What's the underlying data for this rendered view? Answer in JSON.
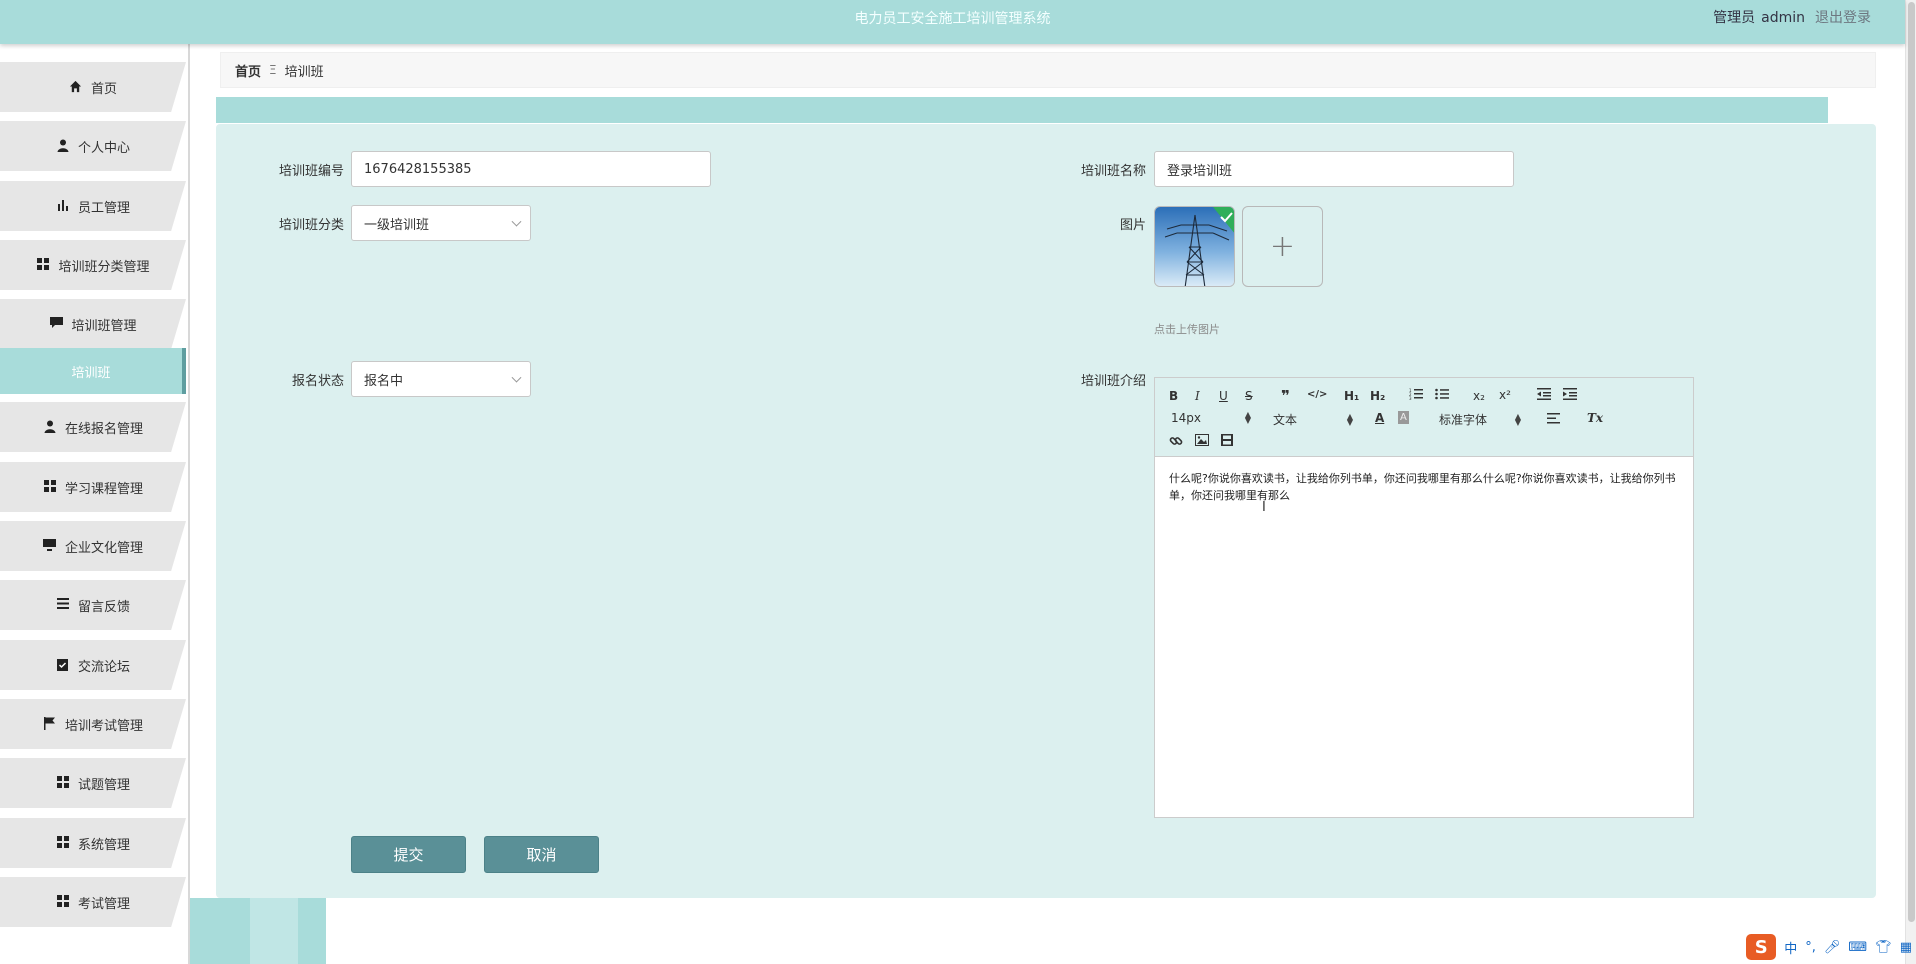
{
  "header": {
    "app_title": "电力员工安全施工培训管理系统",
    "role": "管理员",
    "username": "admin",
    "logout_label": "退出登录"
  },
  "sidebar": {
    "items": [
      {
        "label": "首页",
        "icon": "home-icon"
      },
      {
        "label": "个人中心",
        "icon": "user-icon"
      },
      {
        "label": "员工管理",
        "icon": "bar-chart-icon"
      },
      {
        "label": "培训班分类管理",
        "icon": "grid-icon"
      },
      {
        "label": "培训班管理",
        "icon": "comment-icon"
      },
      {
        "label": "培训班",
        "icon": "",
        "active": true
      },
      {
        "label": "在线报名管理",
        "icon": "user-tie-icon"
      },
      {
        "label": "学习课程管理",
        "icon": "grid-icon"
      },
      {
        "label": "企业文化管理",
        "icon": "monitor-icon"
      },
      {
        "label": "留言反馈",
        "icon": "list-icon"
      },
      {
        "label": "交流论坛",
        "icon": "clipboard-check-icon"
      },
      {
        "label": "培训考试管理",
        "icon": "flag-icon"
      },
      {
        "label": "试题管理",
        "icon": "grid-icon"
      },
      {
        "label": "系统管理",
        "icon": "grid-icon"
      },
      {
        "label": "考试管理",
        "icon": "grid-icon"
      }
    ]
  },
  "breadcrumb": {
    "home": "首页",
    "separator": "Ξ",
    "current": "培训班"
  },
  "form": {
    "class_no_label": "培训班编号",
    "class_no_value": "1676428155385",
    "class_name_label": "培训班名称",
    "class_name_value": "登录培训班",
    "category_label": "培训班分类",
    "category_value": "一级培训班",
    "image_label": "图片",
    "upload_hint": "点击上传图片",
    "status_label": "报名状态",
    "status_value": "报名中",
    "intro_label": "培训班介绍",
    "intro_text": "什么呢?你说你喜欢读书，让我给你列书单，你还问我哪里有那么什么呢?你说你喜欢读书，让我给你列书单，你还问我哪里有那么",
    "submit_label": "提交",
    "cancel_label": "取消"
  },
  "editor_toolbar": {
    "font_size": "14px",
    "block_format": "文本",
    "font_family": "标准字体",
    "bold": "B",
    "italic": "I",
    "underline": "U",
    "strike": "S",
    "h1": "H₁",
    "h2": "H₂",
    "subscript": "x₂",
    "superscript": "x²",
    "color": "A",
    "background": "A",
    "clear": "Tx"
  },
  "ime": {
    "mode": "中",
    "punct": "°,"
  },
  "colors": {
    "accent": "#a8dcda",
    "panel": "#dcf0ef",
    "button": "#5a9097"
  }
}
